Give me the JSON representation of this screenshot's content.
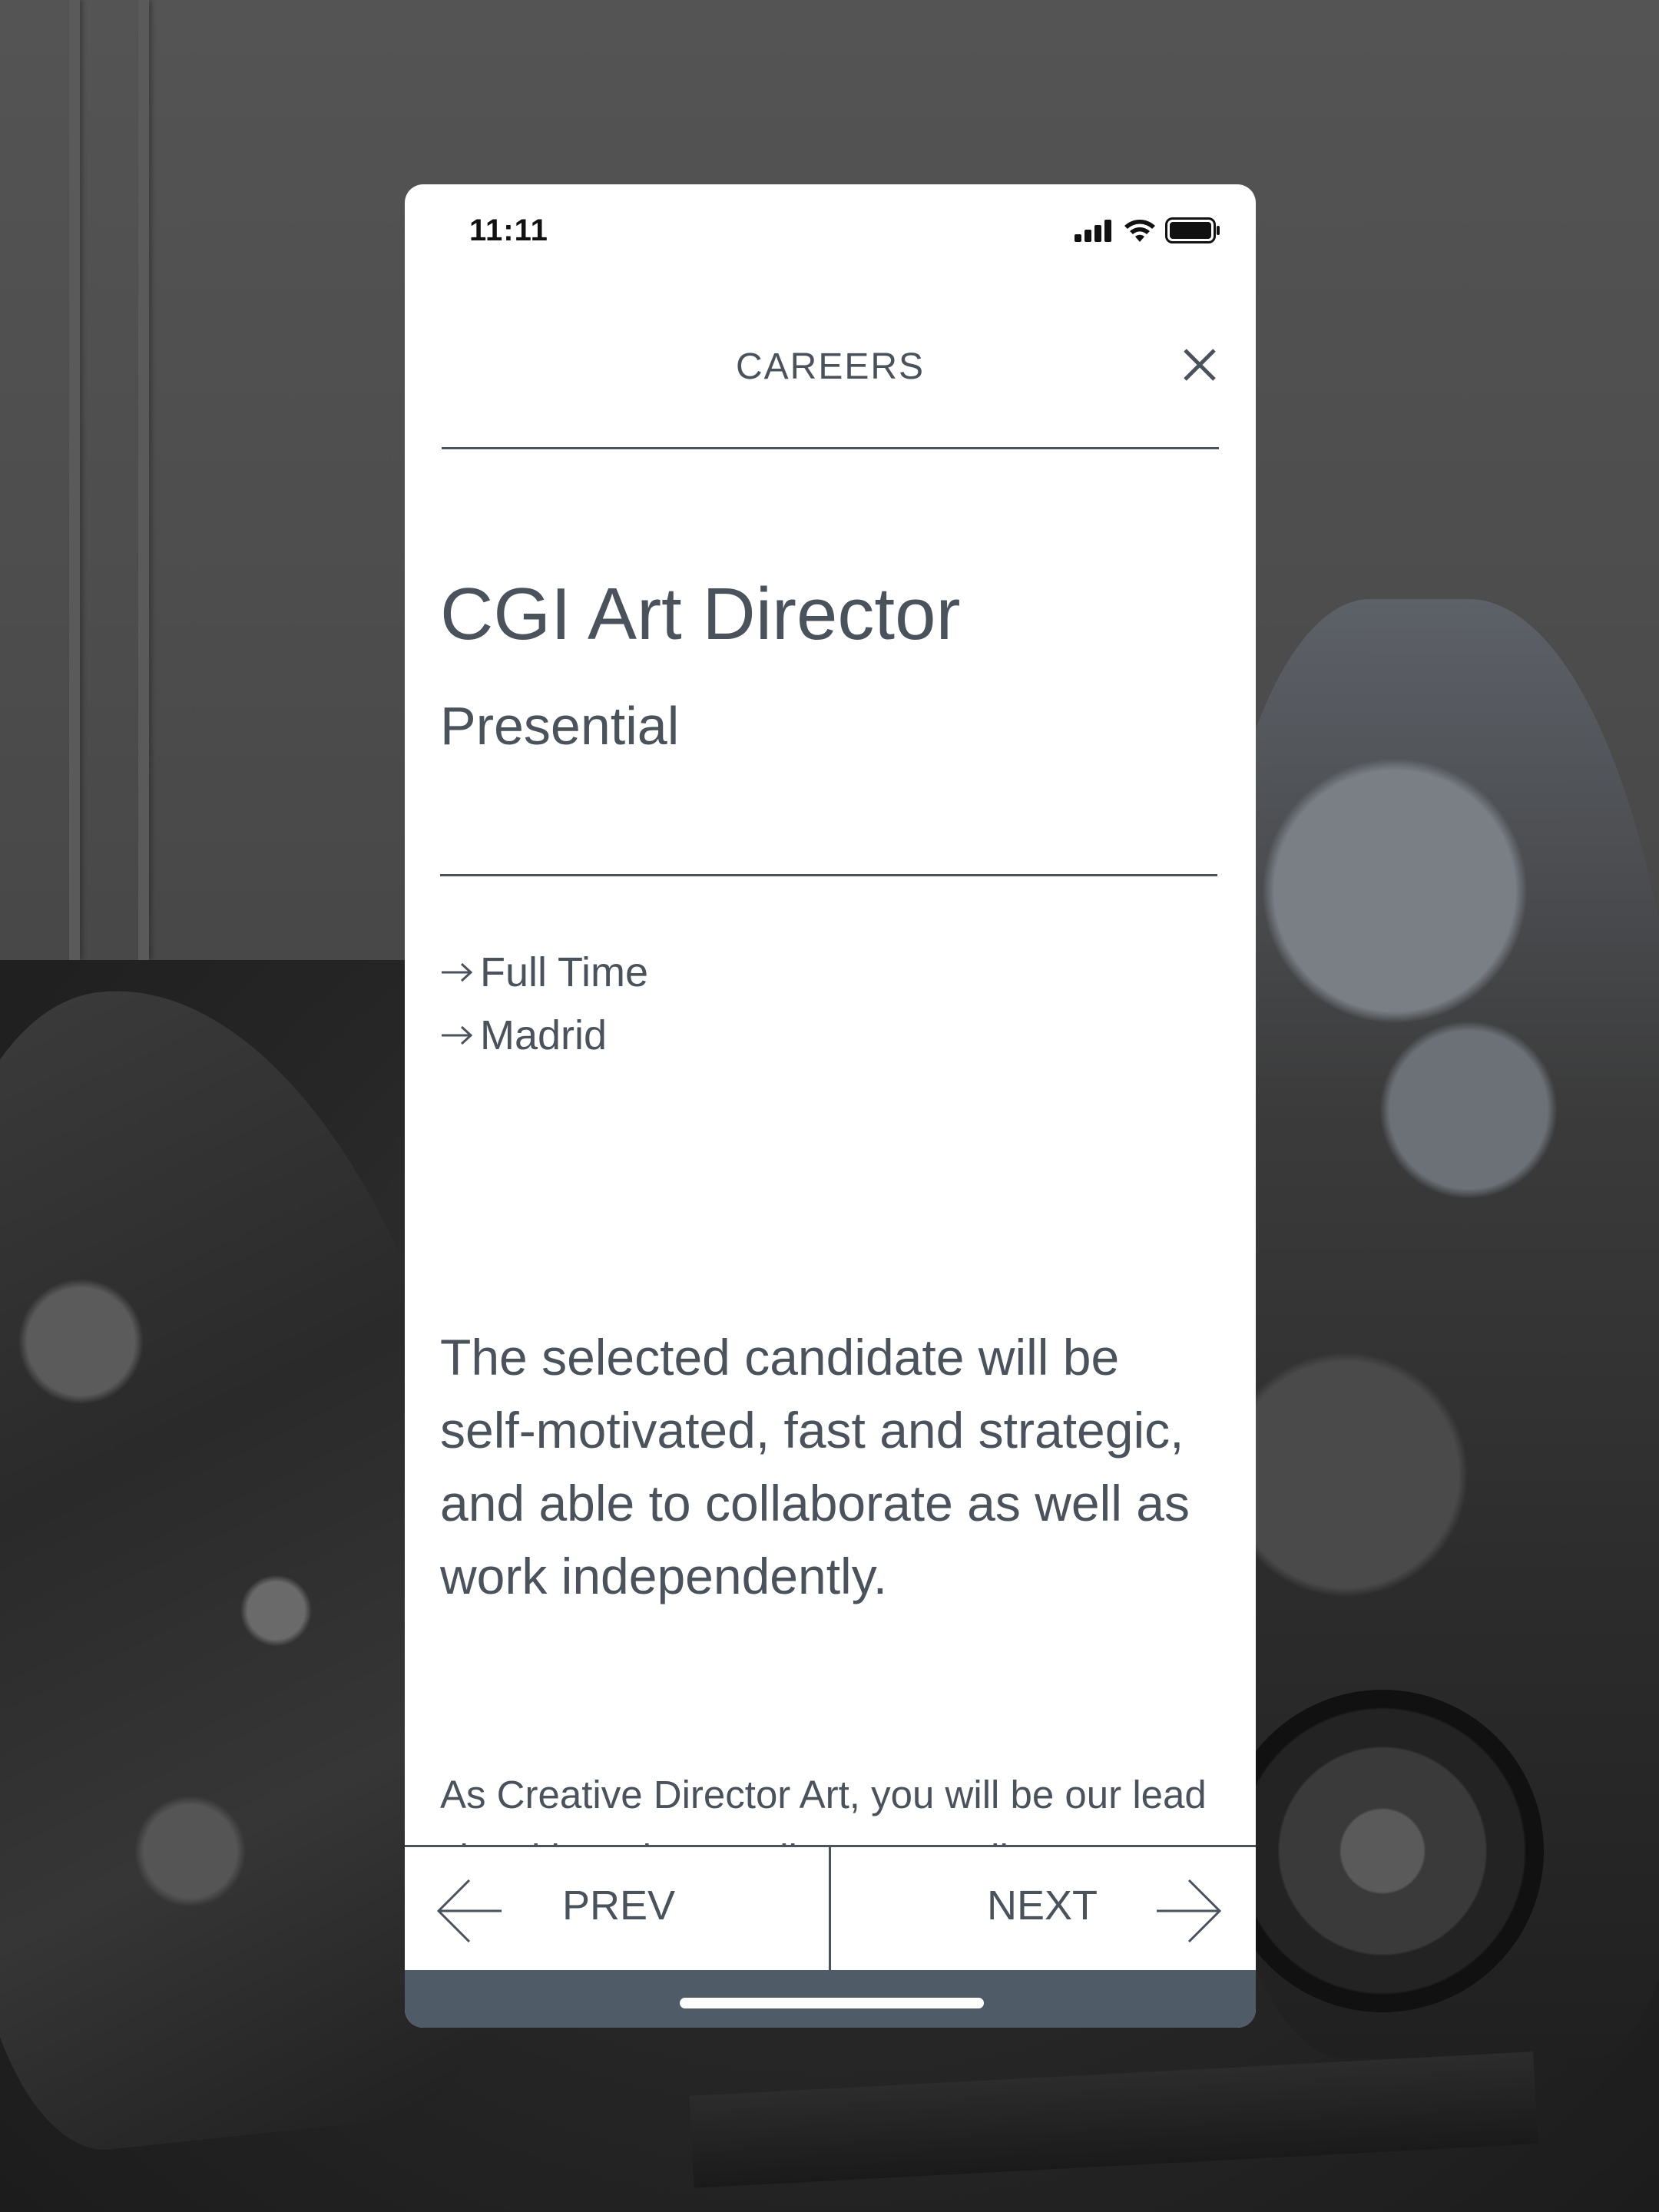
{
  "status_bar": {
    "time": "11:11",
    "icons": [
      "cellular-signal-icon",
      "wifi-icon",
      "battery-icon"
    ]
  },
  "header": {
    "title": "CAREERS",
    "close_icon": "close-icon"
  },
  "job": {
    "title": "CGI Art Director",
    "mode": "Presential",
    "meta": [
      {
        "icon": "arrow-right-icon",
        "label": "Full Time"
      },
      {
        "icon": "arrow-right-icon",
        "label": "Madrid"
      }
    ],
    "lead": "The selected candidate will be self-motivated, fast and strategic, and able to collaborate as well as work independently.",
    "description": "As Creative Director Art, you will be our lead visual brand storyteller across all our marketing channels. Collaborating closely with the Creative Director, Head"
  },
  "pager": {
    "prev_label": "PREV",
    "next_label": "NEXT",
    "prev_icon": "arrow-left-icon",
    "next_icon": "arrow-right-icon"
  },
  "colors": {
    "text": "#4a525c",
    "home_bar_bg": "#4f5b67",
    "card_bg": "#ffffff"
  }
}
